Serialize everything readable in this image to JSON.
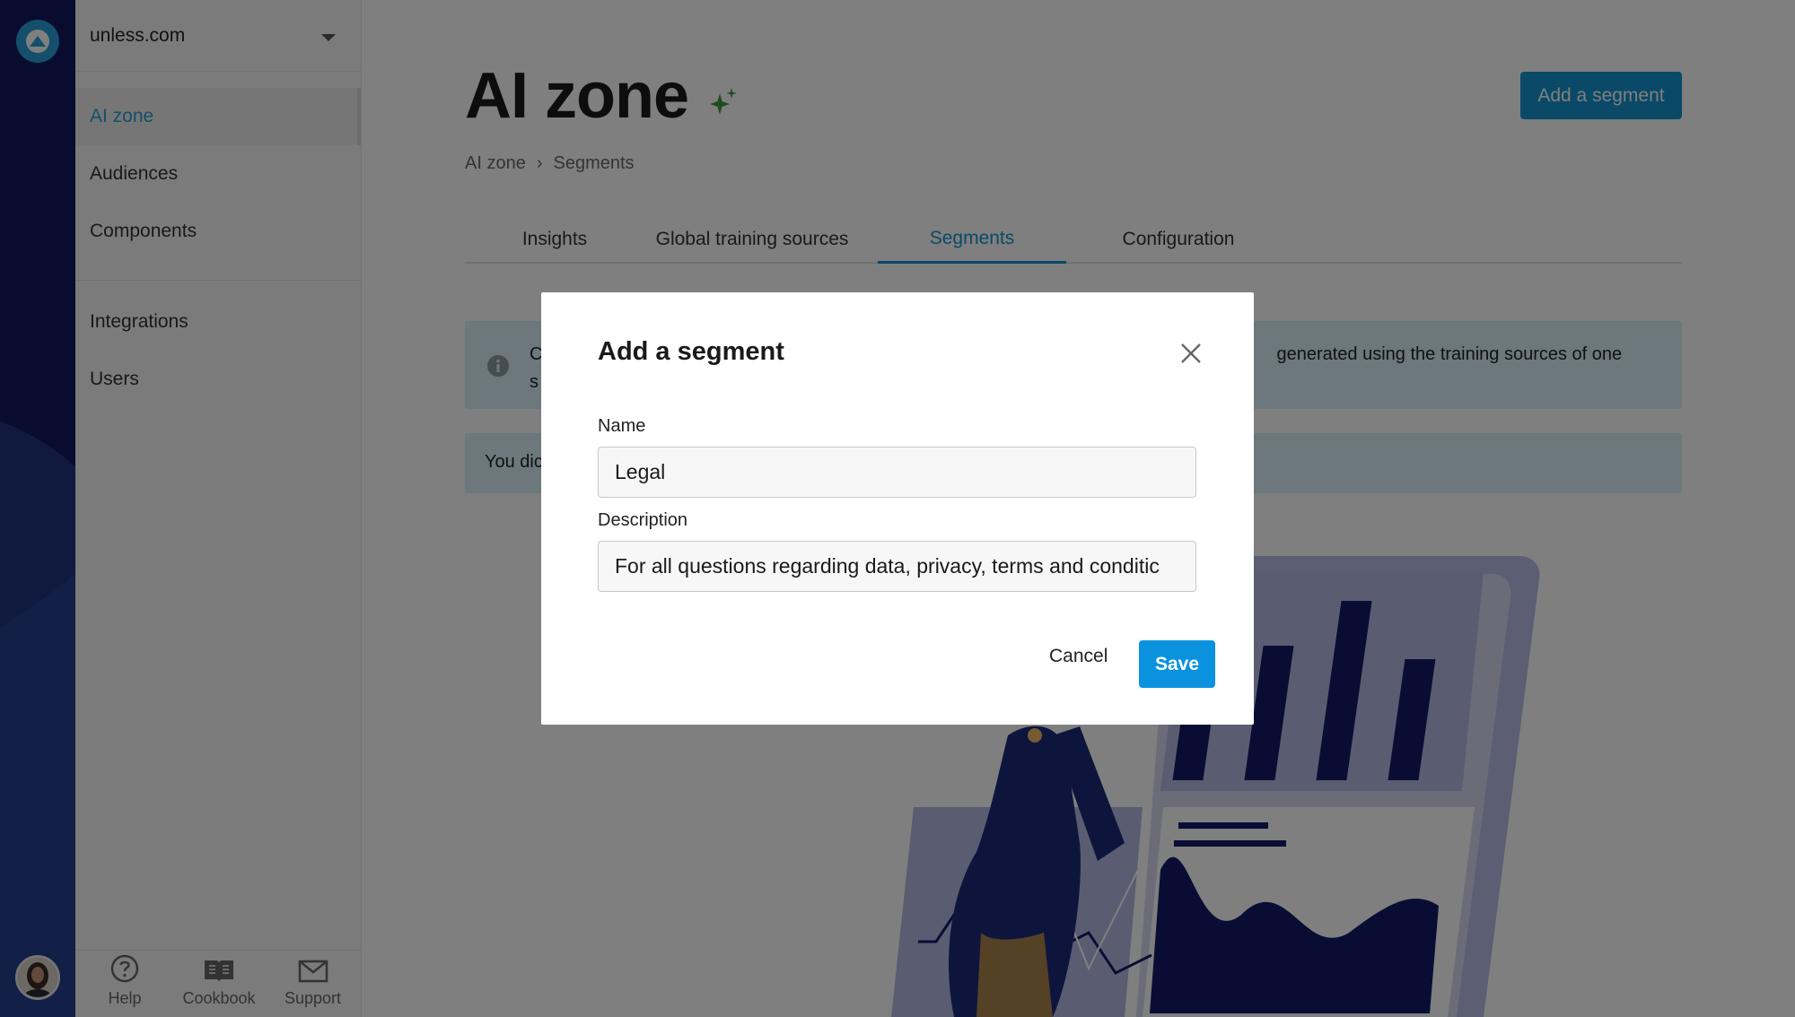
{
  "app": {
    "site_name": "unless.com",
    "accent_color": "#1592cf"
  },
  "sidebar": {
    "items": [
      {
        "label": "AI zone",
        "active": true
      },
      {
        "label": "Audiences"
      },
      {
        "label": "Components"
      },
      {
        "label": "Integrations"
      },
      {
        "label": "Users"
      }
    ],
    "footer": [
      {
        "label": "Help",
        "icon": "help-icon"
      },
      {
        "label": "Cookbook",
        "icon": "book-icon"
      },
      {
        "label": "Support",
        "icon": "mail-icon"
      }
    ]
  },
  "page": {
    "title": "AI zone",
    "add_button": "Add a segment",
    "breadcrumb": {
      "root": "AI zone",
      "separator": "›",
      "current": "Segments"
    },
    "tabs": [
      {
        "label": "Insights"
      },
      {
        "label": "Global training sources"
      },
      {
        "label": "Segments",
        "active": true
      },
      {
        "label": "Configuration"
      }
    ],
    "info_text_start": "C",
    "info_text_line2_start": "s",
    "info_text_end": "generated using the training sources of one",
    "notice_text": "You dic"
  },
  "modal": {
    "title": "Add a segment",
    "name_label": "Name",
    "name_value": "Legal",
    "description_label": "Description",
    "description_value": "For all questions regarding data, privacy, terms and conditic",
    "cancel_label": "Cancel",
    "save_label": "Save"
  }
}
